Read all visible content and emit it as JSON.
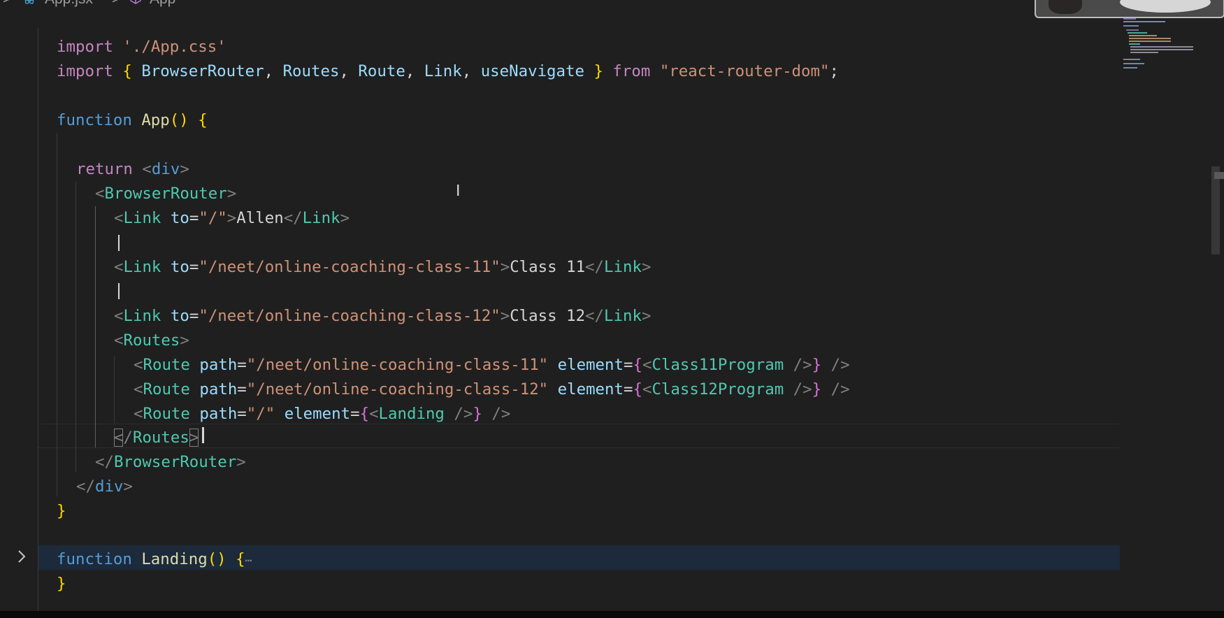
{
  "breadcrumb": {
    "file": "App.jsx",
    "separator": ">",
    "symbol": "App",
    "file_icon": "react-icon",
    "symbol_icon": "cube-icon"
  },
  "colors": {
    "background": "#1f1f1f",
    "keyword": "#569cd6",
    "control_keyword": "#c586c0",
    "function": "#dcdcaa",
    "string": "#ce9178",
    "jsx_tag": "#4ec9b0",
    "attribute": "#9cdcfe",
    "folded_line_highlight": "#1c2a3c"
  },
  "editor": {
    "fold_arrow_icon": "chevron-right-icon",
    "cursor_icon": "text-cursor-icon",
    "folded_ellipsis": "⋯",
    "lines": [
      {
        "name": "import-css",
        "tokens": [
          {
            "t": "import",
            "c": "c-ctl"
          },
          {
            "t": " ",
            "c": "c-txt"
          },
          {
            "t": "'./App.css'",
            "c": "c-str"
          }
        ]
      },
      {
        "name": "import-router",
        "tokens": [
          {
            "t": "import",
            "c": "c-ctl"
          },
          {
            "t": " ",
            "c": "c-txt"
          },
          {
            "t": "{",
            "c": "c-br1"
          },
          {
            "t": " BrowserRouter",
            "c": "c-id"
          },
          {
            "t": ", ",
            "c": "c-txt"
          },
          {
            "t": "Routes",
            "c": "c-id"
          },
          {
            "t": ", ",
            "c": "c-txt"
          },
          {
            "t": "Route",
            "c": "c-id"
          },
          {
            "t": ", ",
            "c": "c-txt"
          },
          {
            "t": "Link",
            "c": "c-id"
          },
          {
            "t": ", ",
            "c": "c-txt"
          },
          {
            "t": "useNavigate ",
            "c": "c-id"
          },
          {
            "t": "}",
            "c": "c-br1"
          },
          {
            "t": " ",
            "c": "c-txt"
          },
          {
            "t": "from",
            "c": "c-ctl"
          },
          {
            "t": " ",
            "c": "c-txt"
          },
          {
            "t": "\"react-router-dom\"",
            "c": "c-str"
          },
          {
            "t": ";",
            "c": "c-txt"
          }
        ]
      },
      {
        "name": "blank",
        "tokens": []
      },
      {
        "name": "function-app",
        "tokens": [
          {
            "t": "function",
            "c": "c-kw"
          },
          {
            "t": " ",
            "c": "c-txt"
          },
          {
            "t": "App",
            "c": "c-fn"
          },
          {
            "t": "()",
            "c": "c-br1"
          },
          {
            "t": " ",
            "c": "c-txt"
          },
          {
            "t": "{",
            "c": "c-br1"
          }
        ]
      },
      {
        "name": "blank",
        "tokens": []
      },
      {
        "name": "return-div",
        "tokens": [
          {
            "t": "return",
            "c": "c-ctl"
          },
          {
            "t": " ",
            "c": "c-txt"
          },
          {
            "t": "<",
            "c": "c-ang"
          },
          {
            "t": "div",
            "c": "c-kw"
          },
          {
            "t": ">",
            "c": "c-ang"
          }
        ]
      },
      {
        "name": "browserrouter-open",
        "tokens": [
          {
            "t": "<",
            "c": "c-ang"
          },
          {
            "t": "BrowserRouter",
            "c": "c-tag"
          },
          {
            "t": ">",
            "c": "c-ang"
          }
        ]
      },
      {
        "name": "link-allen",
        "tokens": [
          {
            "t": "<",
            "c": "c-ang"
          },
          {
            "t": "Link",
            "c": "c-tag"
          },
          {
            "t": " ",
            "c": "c-txt"
          },
          {
            "t": "to",
            "c": "c-attr"
          },
          {
            "t": "=",
            "c": "c-txt"
          },
          {
            "t": "\"/\"",
            "c": "c-str"
          },
          {
            "t": ">",
            "c": "c-ang"
          },
          {
            "t": "Allen",
            "c": "c-txt"
          },
          {
            "t": "</",
            "c": "c-ang"
          },
          {
            "t": "Link",
            "c": "c-tag"
          },
          {
            "t": ">",
            "c": "c-ang"
          }
        ]
      },
      {
        "name": "caret-line",
        "tokens": []
      },
      {
        "name": "link-class-11",
        "tokens": [
          {
            "t": "<",
            "c": "c-ang"
          },
          {
            "t": "Link",
            "c": "c-tag"
          },
          {
            "t": " ",
            "c": "c-txt"
          },
          {
            "t": "to",
            "c": "c-attr"
          },
          {
            "t": "=",
            "c": "c-txt"
          },
          {
            "t": "\"/neet/online-coaching-class-11\"",
            "c": "c-str"
          },
          {
            "t": ">",
            "c": "c-ang"
          },
          {
            "t": "Class 11",
            "c": "c-txt"
          },
          {
            "t": "</",
            "c": "c-ang"
          },
          {
            "t": "Link",
            "c": "c-tag"
          },
          {
            "t": ">",
            "c": "c-ang"
          }
        ]
      },
      {
        "name": "caret-line",
        "tokens": []
      },
      {
        "name": "link-class-12",
        "tokens": [
          {
            "t": "<",
            "c": "c-ang"
          },
          {
            "t": "Link",
            "c": "c-tag"
          },
          {
            "t": " ",
            "c": "c-txt"
          },
          {
            "t": "to",
            "c": "c-attr"
          },
          {
            "t": "=",
            "c": "c-txt"
          },
          {
            "t": "\"/neet/online-coaching-class-12\"",
            "c": "c-str"
          },
          {
            "t": ">",
            "c": "c-ang"
          },
          {
            "t": "Class 12",
            "c": "c-txt"
          },
          {
            "t": "</",
            "c": "c-ang"
          },
          {
            "t": "Link",
            "c": "c-tag"
          },
          {
            "t": ">",
            "c": "c-ang"
          }
        ]
      },
      {
        "name": "routes-open",
        "tokens": [
          {
            "t": "<",
            "c": "c-ang"
          },
          {
            "t": "Routes",
            "c": "c-tag"
          },
          {
            "t": ">",
            "c": "c-ang"
          }
        ]
      },
      {
        "name": "route-class-11",
        "tokens": [
          {
            "t": "<",
            "c": "c-ang"
          },
          {
            "t": "Route",
            "c": "c-tag"
          },
          {
            "t": " ",
            "c": "c-txt"
          },
          {
            "t": "path",
            "c": "c-attr"
          },
          {
            "t": "=",
            "c": "c-txt"
          },
          {
            "t": "\"/neet/online-coaching-class-11\"",
            "c": "c-str"
          },
          {
            "t": " ",
            "c": "c-txt"
          },
          {
            "t": "element",
            "c": "c-attr"
          },
          {
            "t": "=",
            "c": "c-txt"
          },
          {
            "t": "{",
            "c": "c-br2"
          },
          {
            "t": "<",
            "c": "c-ang"
          },
          {
            "t": "Class11Program",
            "c": "c-tag"
          },
          {
            "t": " />",
            "c": "c-ang"
          },
          {
            "t": "}",
            "c": "c-br2"
          },
          {
            "t": " />",
            "c": "c-ang"
          }
        ]
      },
      {
        "name": "route-class-12",
        "tokens": [
          {
            "t": "<",
            "c": "c-ang"
          },
          {
            "t": "Route",
            "c": "c-tag"
          },
          {
            "t": " ",
            "c": "c-txt"
          },
          {
            "t": "path",
            "c": "c-attr"
          },
          {
            "t": "=",
            "c": "c-txt"
          },
          {
            "t": "\"/neet/online-coaching-class-12\"",
            "c": "c-str"
          },
          {
            "t": " ",
            "c": "c-txt"
          },
          {
            "t": "element",
            "c": "c-attr"
          },
          {
            "t": "=",
            "c": "c-txt"
          },
          {
            "t": "{",
            "c": "c-br2"
          },
          {
            "t": "<",
            "c": "c-ang"
          },
          {
            "t": "Class12Program",
            "c": "c-tag"
          },
          {
            "t": " />",
            "c": "c-ang"
          },
          {
            "t": "}",
            "c": "c-br2"
          },
          {
            "t": " />",
            "c": "c-ang"
          }
        ]
      },
      {
        "name": "route-landing",
        "tokens": [
          {
            "t": "<",
            "c": "c-ang"
          },
          {
            "t": "Route",
            "c": "c-tag"
          },
          {
            "t": " ",
            "c": "c-txt"
          },
          {
            "t": "path",
            "c": "c-attr"
          },
          {
            "t": "=",
            "c": "c-txt"
          },
          {
            "t": "\"/\"",
            "c": "c-str"
          },
          {
            "t": " ",
            "c": "c-txt"
          },
          {
            "t": "element",
            "c": "c-attr"
          },
          {
            "t": "=",
            "c": "c-txt"
          },
          {
            "t": "{",
            "c": "c-br2"
          },
          {
            "t": "<",
            "c": "c-ang"
          },
          {
            "t": "Landing",
            "c": "c-tag"
          },
          {
            "t": " />",
            "c": "c-ang"
          },
          {
            "t": "}",
            "c": "c-br2"
          },
          {
            "t": " />",
            "c": "c-ang"
          }
        ]
      },
      {
        "name": "routes-close",
        "tokens": [
          {
            "t": "<",
            "c": "c-ang c-boxed"
          },
          {
            "t": "/",
            "c": "c-ang"
          },
          {
            "t": "Routes",
            "c": "c-tag"
          },
          {
            "t": ">",
            "c": "c-ang c-boxed"
          }
        ]
      },
      {
        "name": "browserrouter-close",
        "tokens": [
          {
            "t": "</",
            "c": "c-ang"
          },
          {
            "t": "BrowserRouter",
            "c": "c-tag"
          },
          {
            "t": ">",
            "c": "c-ang"
          }
        ]
      },
      {
        "name": "div-close",
        "tokens": [
          {
            "t": "</",
            "c": "c-ang"
          },
          {
            "t": "div",
            "c": "c-kw"
          },
          {
            "t": ">",
            "c": "c-ang"
          }
        ]
      },
      {
        "name": "app-close-brace",
        "tokens": [
          {
            "t": "}",
            "c": "c-br1"
          }
        ]
      },
      {
        "name": "blank",
        "tokens": []
      },
      {
        "name": "function-landing",
        "tokens": [
          {
            "t": "function",
            "c": "c-kw"
          },
          {
            "t": " ",
            "c": "c-txt"
          },
          {
            "t": "Landing",
            "c": "c-fn"
          },
          {
            "t": "()",
            "c": "c-br1"
          },
          {
            "t": " ",
            "c": "c-txt"
          },
          {
            "t": "{",
            "c": "c-br1"
          },
          {
            "t": "⋯",
            "c": "c-ell"
          }
        ]
      },
      {
        "name": "landing-close-brace",
        "tokens": [
          {
            "t": "}",
            "c": "c-br1"
          }
        ]
      }
    ]
  }
}
